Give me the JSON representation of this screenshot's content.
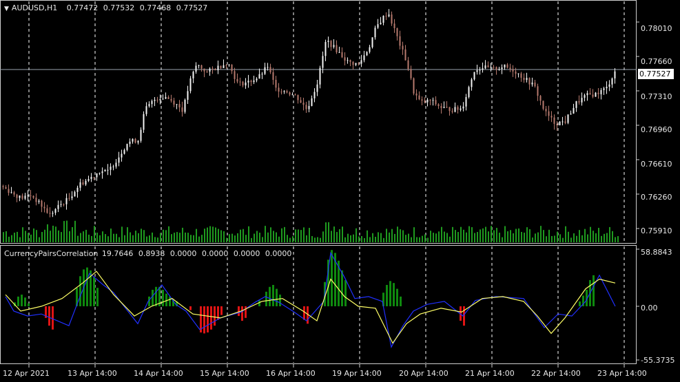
{
  "header": {
    "symbol": "AUDUSD,H1",
    "open": "0.77472",
    "high": "0.77532",
    "low": "0.77468",
    "close": "0.77527"
  },
  "indicator": {
    "name": "CurrencyPairsCorrelation",
    "values": [
      "19.7646",
      "0.8938",
      "0.0000",
      "0.0000",
      "0.0000",
      "0.0000"
    ],
    "axis_labels": [
      "58.8843",
      "0.00",
      "-55.3735"
    ]
  },
  "price_axis": {
    "labels": [
      "0.78010",
      "0.77660",
      "0.77310",
      "0.76960",
      "0.76610",
      "0.76260",
      "0.75910"
    ],
    "current": "0.77527"
  },
  "time_axis": {
    "labels": [
      "12 Apr 2021",
      "13 Apr 14:00",
      "14 Apr 14:00",
      "15 Apr 14:00",
      "16 Apr 14:00",
      "19 Apr 14:00",
      "20 Apr 14:00",
      "21 Apr 14:00",
      "22 Apr 14:00",
      "23 Apr 14:00"
    ]
  },
  "colors": {
    "background": "#000000",
    "grid": "#ffffff",
    "bull_candle": "#f5f5f5",
    "bear_candle": "#b77a6e",
    "volume": "#1f9a1f",
    "hist_green": "#0f8a0f",
    "hist_red": "#e11414",
    "line_yellow": "#ffff66",
    "line_blue": "#2030ff"
  },
  "chart_data": [
    {
      "type": "candlestick",
      "title": "AUDUSD,H1",
      "ylim": [
        0.7577,
        0.7822
      ],
      "y_ticks": [
        0.7801,
        0.7766,
        0.7731,
        0.7696,
        0.7661,
        0.7626,
        0.7591
      ],
      "current_price": 0.77527,
      "close_path": [
        [
          0,
          0.7635
        ],
        [
          15,
          0.7628
        ],
        [
          30,
          0.7622
        ],
        [
          45,
          0.7625
        ],
        [
          60,
          0.7614
        ],
        [
          72,
          0.7605
        ],
        [
          85,
          0.7614
        ],
        [
          100,
          0.7622
        ],
        [
          115,
          0.7636
        ],
        [
          130,
          0.7642
        ],
        [
          145,
          0.765
        ],
        [
          155,
          0.7648
        ],
        [
          170,
          0.7662
        ],
        [
          185,
          0.7679
        ],
        [
          200,
          0.7681
        ],
        [
          210,
          0.7712
        ],
        [
          225,
          0.7723
        ],
        [
          240,
          0.7725
        ],
        [
          255,
          0.7718
        ],
        [
          265,
          0.7711
        ],
        [
          275,
          0.774
        ],
        [
          285,
          0.7758
        ],
        [
          300,
          0.775
        ],
        [
          315,
          0.7755
        ],
        [
          330,
          0.776
        ],
        [
          345,
          0.7738
        ],
        [
          360,
          0.774
        ],
        [
          375,
          0.7745
        ],
        [
          388,
          0.7756
        ],
        [
          400,
          0.7733
        ],
        [
          415,
          0.7731
        ],
        [
          430,
          0.7725
        ],
        [
          445,
          0.7712
        ],
        [
          460,
          0.7739
        ],
        [
          473,
          0.7783
        ],
        [
          490,
          0.7771
        ],
        [
          505,
          0.776
        ],
        [
          520,
          0.7758
        ],
        [
          535,
          0.7775
        ],
        [
          545,
          0.7795
        ],
        [
          555,
          0.7805
        ],
        [
          563,
          0.7811
        ],
        [
          570,
          0.7797
        ],
        [
          580,
          0.7778
        ],
        [
          590,
          0.776
        ],
        [
          600,
          0.773
        ],
        [
          610,
          0.7719
        ],
        [
          625,
          0.7721
        ],
        [
          640,
          0.7714
        ],
        [
          655,
          0.7712
        ],
        [
          670,
          0.7713
        ],
        [
          688,
          0.7752
        ],
        [
          700,
          0.7755
        ],
        [
          715,
          0.7753
        ],
        [
          730,
          0.7756
        ],
        [
          745,
          0.7752
        ],
        [
          760,
          0.7744
        ],
        [
          775,
          0.7736
        ],
        [
          790,
          0.771
        ],
        [
          805,
          0.7698
        ],
        [
          820,
          0.77
        ],
        [
          835,
          0.7718
        ],
        [
          850,
          0.7726
        ],
        [
          865,
          0.7728
        ],
        [
          880,
          0.7734
        ],
        [
          893,
          0.7752
        ]
      ]
    },
    {
      "type": "bar",
      "title": "CurrencyPairsCorrelation",
      "ylim": [
        -55.3735,
        58.8843
      ],
      "series": [
        {
          "values": [
            [
              20,
              4
            ],
            [
              25,
              10
            ],
            [
              30,
              12
            ],
            [
              35,
              9
            ],
            [
              40,
              3
            ],
            [
              65,
              -12
            ],
            [
              70,
              -20
            ],
            [
              75,
              -24
            ],
            [
              110,
              19
            ],
            [
              115,
              31
            ],
            [
              120,
              38
            ],
            [
              125,
              40
            ],
            [
              130,
              37
            ],
            [
              135,
              30
            ],
            [
              140,
              19
            ],
            [
              215,
              10
            ],
            [
              220,
              17
            ],
            [
              225,
              20
            ],
            [
              230,
              20
            ],
            [
              235,
              17
            ],
            [
              240,
              13
            ],
            [
              245,
              10
            ],
            [
              250,
              7
            ],
            [
              255,
              5
            ],
            [
              275,
              -4
            ],
            [
              290,
              -27
            ],
            [
              295,
              -28
            ],
            [
              300,
              -27
            ],
            [
              305,
              -24
            ],
            [
              310,
              -20
            ],
            [
              315,
              -14
            ],
            [
              320,
              -9
            ],
            [
              345,
              -10
            ],
            [
              350,
              -15
            ],
            [
              355,
              -12
            ],
            [
              375,
              6
            ],
            [
              385,
              15
            ],
            [
              390,
              20
            ],
            [
              395,
              22
            ],
            [
              400,
              18
            ],
            [
              405,
              12
            ],
            [
              440,
              -14
            ],
            [
              445,
              -18
            ],
            [
              470,
              25
            ],
            [
              475,
              48
            ],
            [
              480,
              58
            ],
            [
              485,
              55
            ],
            [
              490,
              47
            ],
            [
              495,
              37
            ],
            [
              500,
              27
            ],
            [
              555,
              14
            ],
            [
              560,
              22
            ],
            [
              565,
              26
            ],
            [
              570,
              24
            ],
            [
              575,
              18
            ],
            [
              580,
              10
            ],
            [
              667,
              -15
            ],
            [
              672,
              -20
            ],
            [
              840,
              5
            ],
            [
              845,
              11
            ],
            [
              850,
              17
            ],
            [
              855,
              27
            ],
            [
              860,
              32
            ]
          ]
        },
        {
          "values": [
            [
              8,
              10
            ],
            [
              20,
              -5
            ],
            [
              40,
              -10
            ],
            [
              60,
              -8
            ],
            [
              80,
              -14
            ],
            [
              100,
              -20
            ],
            [
              115,
              8
            ],
            [
              130,
              34
            ],
            [
              150,
              22
            ],
            [
              165,
              14
            ],
            [
              180,
              0
            ],
            [
              200,
              -18
            ],
            [
              215,
              5
            ],
            [
              235,
              22
            ],
            [
              255,
              2
            ],
            [
              270,
              -5
            ],
            [
              290,
              -24
            ],
            [
              320,
              -12
            ],
            [
              350,
              -6
            ],
            [
              370,
              4
            ],
            [
              385,
              10
            ],
            [
              405,
              4
            ],
            [
              425,
              -5
            ],
            [
              445,
              -15
            ],
            [
              470,
              5
            ],
            [
              480,
              55
            ],
            [
              500,
              30
            ],
            [
              515,
              8
            ],
            [
              535,
              10
            ],
            [
              555,
              5
            ],
            [
              568,
              -42
            ],
            [
              585,
              -20
            ],
            [
              600,
              -5
            ],
            [
              620,
              2
            ],
            [
              645,
              5
            ],
            [
              672,
              -10
            ],
            [
              690,
              6
            ],
            [
              720,
              10
            ],
            [
              760,
              8
            ],
            [
              790,
              -22
            ],
            [
              810,
              -8
            ],
            [
              830,
              -10
            ],
            [
              850,
              5
            ],
            [
              870,
              32
            ],
            [
              893,
              0
            ]
          ]
        },
        {
          "values": [
            [
              8,
              12
            ],
            [
              30,
              -5
            ],
            [
              60,
              0
            ],
            [
              90,
              8
            ],
            [
              120,
              24
            ],
            [
              140,
              36
            ],
            [
              165,
              12
            ],
            [
              195,
              -10
            ],
            [
              220,
              0
            ],
            [
              250,
              8
            ],
            [
              280,
              -8
            ],
            [
              320,
              -12
            ],
            [
              350,
              -5
            ],
            [
              380,
              5
            ],
            [
              410,
              8
            ],
            [
              440,
              -5
            ],
            [
              460,
              -15
            ],
            [
              480,
              28
            ],
            [
              500,
              10
            ],
            [
              520,
              0
            ],
            [
              545,
              -2
            ],
            [
              570,
              -38
            ],
            [
              590,
              -18
            ],
            [
              610,
              -8
            ],
            [
              640,
              -2
            ],
            [
              670,
              -6
            ],
            [
              700,
              8
            ],
            [
              730,
              10
            ],
            [
              760,
              5
            ],
            [
              780,
              -10
            ],
            [
              800,
              -28
            ],
            [
              820,
              -12
            ],
            [
              850,
              18
            ],
            [
              870,
              28
            ],
            [
              893,
              24
            ]
          ]
        }
      ]
    }
  ]
}
